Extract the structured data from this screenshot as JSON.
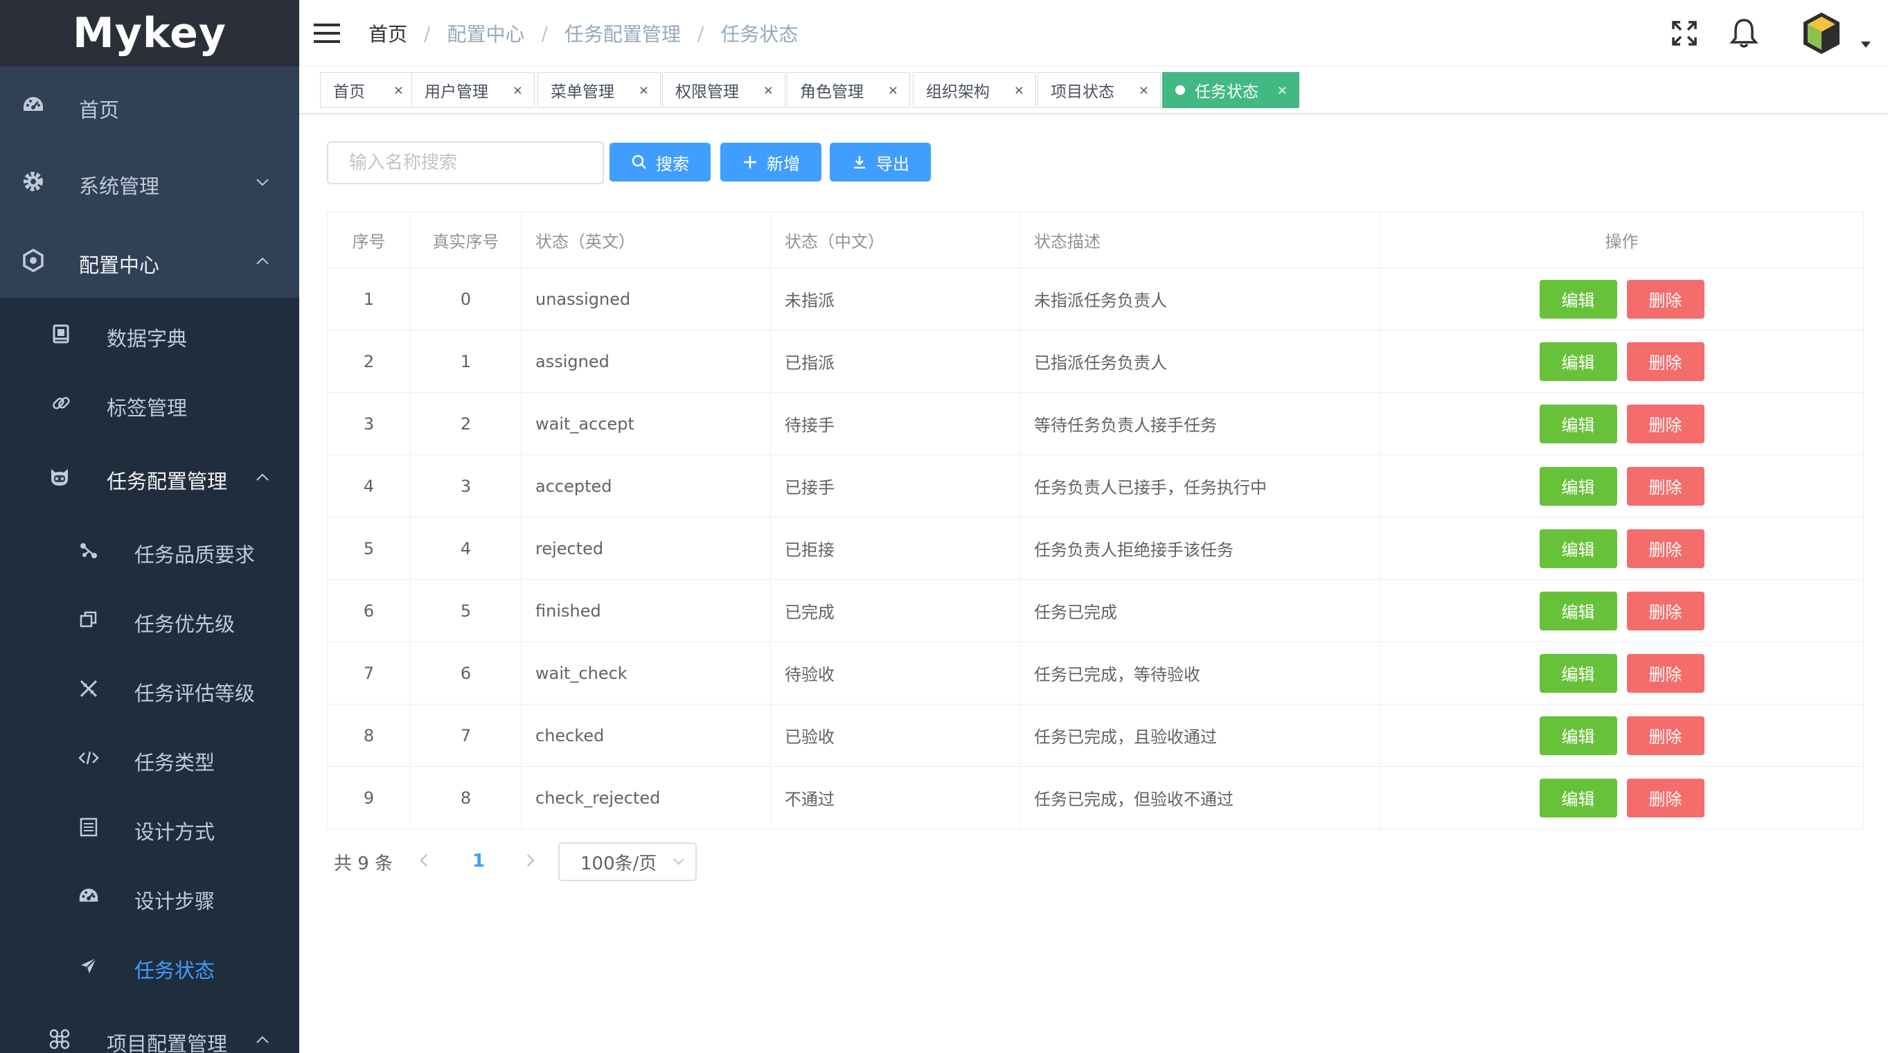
{
  "app": {
    "logo": "Mykey"
  },
  "sidebar": {
    "items": [
      {
        "label": "首页",
        "icon": "dashboard-icon"
      },
      {
        "label": "系统管理",
        "icon": "gear-icon"
      },
      {
        "label": "配置中心",
        "icon": "hexagon-settings-icon"
      },
      {
        "label": "数据字典",
        "icon": "dictionary-icon"
      },
      {
        "label": "标签管理",
        "icon": "link-icon"
      },
      {
        "label": "任务配置管理",
        "icon": "github-cat-icon"
      },
      {
        "label": "任务品质要求",
        "icon": "share-icon"
      },
      {
        "label": "任务优先级",
        "icon": "copy-icon"
      },
      {
        "label": "任务评估等级",
        "icon": "edit-ruler-icon"
      },
      {
        "label": "任务类型",
        "icon": "code-icon"
      },
      {
        "label": "设计方式",
        "icon": "list-icon"
      },
      {
        "label": "设计步骤",
        "icon": "dashboard-icon"
      },
      {
        "label": "任务状态",
        "icon": "paper-plane-icon"
      },
      {
        "label": "项目配置管理",
        "icon": "command-icon"
      }
    ]
  },
  "breadcrumb": [
    "首页",
    "配置中心",
    "任务配置管理",
    "任务状态"
  ],
  "tags": [
    {
      "label": "首页"
    },
    {
      "label": "用户管理"
    },
    {
      "label": "菜单管理"
    },
    {
      "label": "权限管理"
    },
    {
      "label": "角色管理"
    },
    {
      "label": "组织架构"
    },
    {
      "label": "项目状态"
    },
    {
      "label": "任务状态"
    }
  ],
  "tag_close": "×",
  "toolbar": {
    "search_placeholder": "输入名称搜索",
    "search_label": "搜索",
    "add_label": "新增",
    "export_label": "导出"
  },
  "table": {
    "headers": [
      "序号",
      "真实序号",
      "状态（英文）",
      "状态（中文）",
      "状态描述",
      "操作"
    ],
    "edit_label": "编辑",
    "delete_label": "删除",
    "rows": [
      {
        "no": "1",
        "real": "0",
        "en": "unassigned",
        "cn": "未指派",
        "desc": "未指派任务负责人"
      },
      {
        "no": "2",
        "real": "1",
        "en": "assigned",
        "cn": "已指派",
        "desc": "已指派任务负责人"
      },
      {
        "no": "3",
        "real": "2",
        "en": "wait_accept",
        "cn": "待接手",
        "desc": "等待任务负责人接手任务"
      },
      {
        "no": "4",
        "real": "3",
        "en": "accepted",
        "cn": "已接手",
        "desc": "任务负责人已接手，任务执行中"
      },
      {
        "no": "5",
        "real": "4",
        "en": "rejected",
        "cn": "已拒接",
        "desc": "任务负责人拒绝接手该任务"
      },
      {
        "no": "6",
        "real": "5",
        "en": "finished",
        "cn": "已完成",
        "desc": "任务已完成"
      },
      {
        "no": "7",
        "real": "6",
        "en": "wait_check",
        "cn": "待验收",
        "desc": "任务已完成，等待验收"
      },
      {
        "no": "8",
        "real": "7",
        "en": "checked",
        "cn": "已验收",
        "desc": "任务已完成，且验收通过"
      },
      {
        "no": "9",
        "real": "8",
        "en": "check_rejected",
        "cn": "不通过",
        "desc": "任务已完成，但验收不通过"
      }
    ]
  },
  "pagination": {
    "total": "共 9 条",
    "current": "1",
    "page_size": "100条/页"
  },
  "colors": {
    "sidebar_bg": "#304156",
    "submenu_bg": "#1f2d3d",
    "active_menu": "#409eff",
    "active_tag": "#42b983",
    "primary": "#409eff",
    "edit": "#67c23a",
    "delete": "#f56c6c"
  }
}
